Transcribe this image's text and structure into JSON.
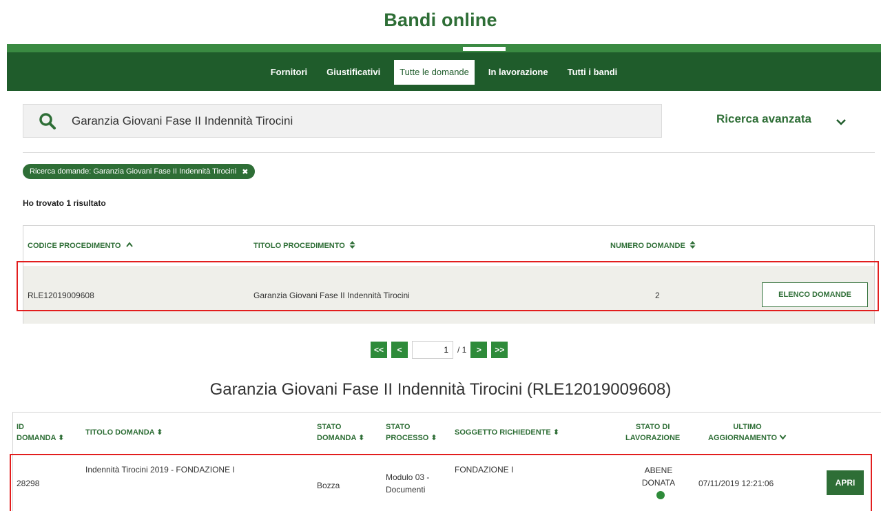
{
  "app": {
    "title": "Bandi online"
  },
  "nav": {
    "items": [
      {
        "label": "Fornitori",
        "active": false
      },
      {
        "label": "Giustificativi",
        "active": false
      },
      {
        "label": "Tutte le domande",
        "active": true
      },
      {
        "label": "In lavorazione",
        "active": false
      },
      {
        "label": "Tutti i bandi",
        "active": false
      }
    ]
  },
  "search": {
    "value": "Garanzia Giovani Fase II Indennità Tirocini",
    "icon": "search-icon",
    "advanced_label": "Ricerca avanzata"
  },
  "filter": {
    "chip_label": "Ricerca domande: Garanzia Giovani Fase II Indennità Tirocini",
    "close_glyph": "✖"
  },
  "results": {
    "count_text": "Ho trovato 1 risultato"
  },
  "procedures_table": {
    "headers": {
      "codice": "CODICE PROCEDIMENTO",
      "titolo": "TITOLO PROCEDIMENTO",
      "numero": "NUMERO DOMANDE"
    },
    "rows": [
      {
        "codice": "RLE12019009608",
        "titolo": "Garanzia Giovani Fase II Indennità Tirocini",
        "numero": "2",
        "action": "ELENCO DOMANDE"
      }
    ]
  },
  "pagination": {
    "first": "<<",
    "prev": "<",
    "current": "1",
    "total": "/ 1",
    "next": ">",
    "last": ">>"
  },
  "section": {
    "title": "Garanzia Giovani Fase II Indennità Tirocini (RLE12019009608)"
  },
  "domande_table": {
    "headers": {
      "id_line1": "ID",
      "id_line2": "DOMANDA",
      "titolo": "TITOLO DOMANDA",
      "stato_domanda_line1": "STATO",
      "stato_domanda_line2": "DOMANDA",
      "stato_processo_line1": "STATO",
      "stato_processo_line2": "PROCESSO",
      "soggetto": "SOGGETTO RICHIEDENTE",
      "stato_lav_line1": "STATO DI",
      "stato_lav_line2": "LAVORAZIONE",
      "ultimo_line1": "ULTIMO",
      "ultimo_line2": "AGGIORNAMENTO"
    },
    "rows": [
      {
        "id": "28298",
        "titolo": "Indennità Tirocini 2019 - FONDAZIONE I",
        "stato_domanda": "Bozza",
        "stato_processo_line1": "Modulo 03 -",
        "stato_processo_line2": "Documenti",
        "soggetto": "FONDAZIONE I",
        "stato_lav_line1": "ABENE",
        "stato_lav_line2": "DONATA",
        "ultimo": "07/11/2019 12:21:06",
        "action": "APRI"
      }
    ]
  },
  "colors": {
    "brand_green": "#2e6e36",
    "nav_green": "#1f5c2b",
    "highlight_red": "#e21e1e",
    "status_dot": "#2e8b3a"
  }
}
